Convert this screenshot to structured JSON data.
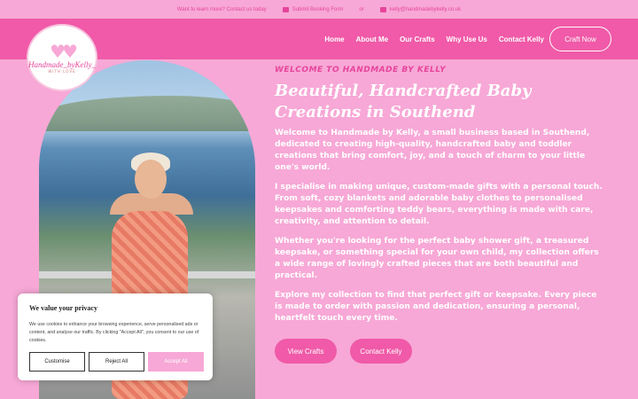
{
  "topbar": {
    "question": "Want to learn more? Contact us today",
    "booking_label": "Submit Booking Form",
    "separator": "or",
    "email": "kelly@handmadebykelly.co.uk"
  },
  "logo": {
    "brand": "Handmade_byKelly_",
    "sub": "WITH LOVE"
  },
  "nav": {
    "items": [
      "Home",
      "About Me",
      "Our Crafts",
      "Why Use Us",
      "Contact Kelly"
    ],
    "cta": "Craft Now"
  },
  "hero": {
    "eyebrow": "WELCOME TO HANDMADE BY KELLY",
    "headline": "Beautiful, Handcrafted Baby Creations in Southend",
    "paragraphs": [
      "Welcome to Handmade by Kelly, a small business based in Southend, dedicated to creating high-quality, handcrafted baby and toddler creations that bring comfort, joy, and a touch of charm to your little one's world.",
      "I specialise in making unique, custom-made gifts with a personal touch. From soft, cozy blankets and adorable baby clothes to personalised keepsakes and comforting teddy bears, everything is made with care, creativity, and attention to detail.",
      "Whether you're looking for the perfect baby shower gift, a treasured keepsake, or something special for your own child, my collection offers a wide range of lovingly crafted pieces that are both beautiful and practical.",
      "Explore my collection to find that perfect gift or keepsake. Every piece is made to order with passion and dedication, ensuring a personal, heartfelt touch every time."
    ],
    "btn_view": "View Crafts",
    "btn_contact": "Contact Kelly"
  },
  "cookie": {
    "title": "We value your privacy",
    "text": "We use cookies to enhance your browsing experience, serve personalised ads or content, and analyse our traffic. By clicking \"Accept All\", you consent to our use of cookies.",
    "customise": "Customise",
    "reject": "Reject All",
    "accept": "Accept All"
  },
  "colors": {
    "bg": "#f7a8d6",
    "header": "#f05aa8",
    "accent": "#e6459b"
  }
}
